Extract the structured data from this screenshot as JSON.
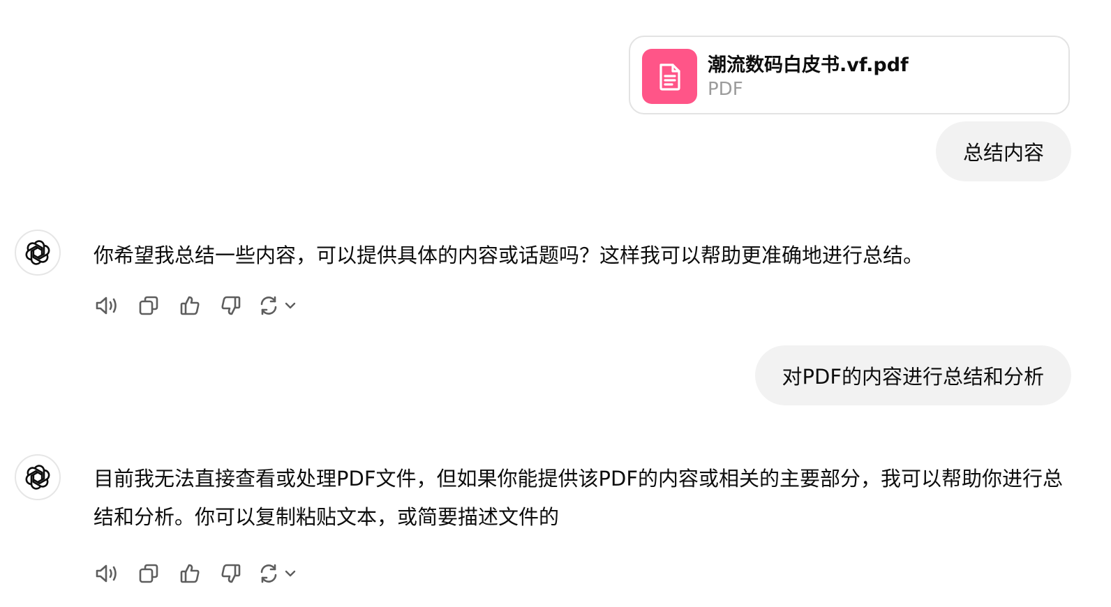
{
  "attachment": {
    "file_name": "潮流数码白皮书.vf.pdf",
    "file_type": "PDF",
    "icon": "document-icon",
    "icon_bg_color": "#ff5588"
  },
  "messages": {
    "user_1": "总结内容",
    "assistant_1": "你希望我总结一些内容，可以提供具体的内容或话题吗？这样我可以帮助更准确地进行总结。",
    "user_2": "对PDF的内容进行总结和分析",
    "assistant_2": "目前我无法直接查看或处理PDF文件，但如果你能提供该PDF的内容或相关的主要部分，我可以帮助你进行总结和分析。你可以复制粘贴文本，或简要描述文件的"
  },
  "assistant_avatar_icon": "openai-logo-icon",
  "message_actions": [
    "speaker-icon",
    "copy-icon",
    "thumbs-up-icon",
    "thumbs-down-icon",
    "regenerate-icon",
    "chevron-down-icon"
  ],
  "colors": {
    "user_bubble_bg": "#f2f2f2",
    "icon_gray": "#5d5d5d"
  }
}
